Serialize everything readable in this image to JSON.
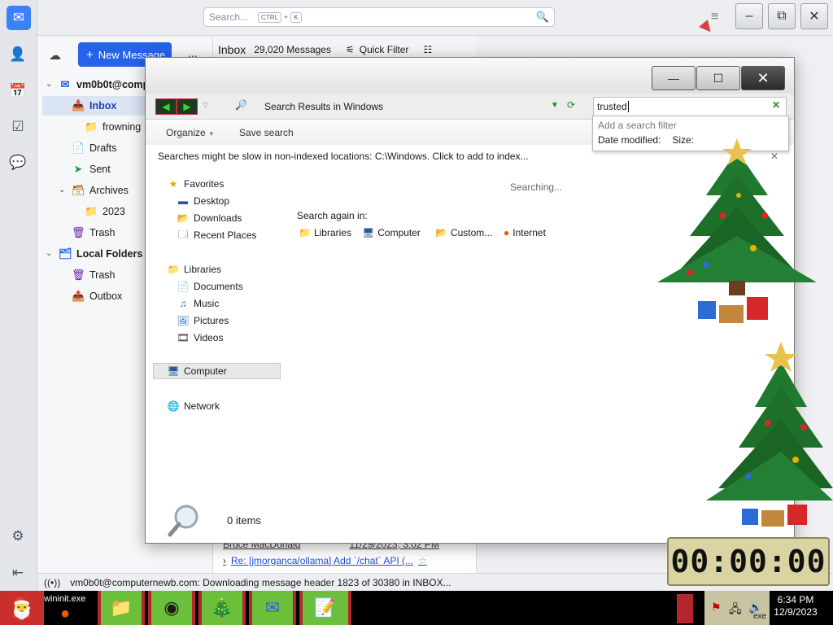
{
  "thunderbird": {
    "search_placeholder": "Search...",
    "search_shortcut_ctrl": "CTRL",
    "search_shortcut_plus": "+",
    "search_shortcut_key": "K",
    "new_message_label": "New Message",
    "more_label": "...",
    "account": "vm0b0t@comp",
    "folders": [
      {
        "label": "Inbox",
        "icon": "inbox-icon"
      },
      {
        "label": "frowning",
        "icon": "folder-icon"
      },
      {
        "label": "Drafts",
        "icon": "drafts-icon"
      },
      {
        "label": "Sent",
        "icon": "send-icon"
      },
      {
        "label": "Archives",
        "icon": "archive-icon"
      },
      {
        "label": "2023",
        "icon": "folder-icon"
      },
      {
        "label": "Trash",
        "icon": "trash-icon"
      }
    ],
    "local_folders_label": "Local Folders",
    "local_folders": [
      {
        "label": "Trash",
        "icon": "trash-icon"
      },
      {
        "label": "Outbox",
        "icon": "outbox-icon"
      }
    ],
    "list_title": "Inbox",
    "message_count": "29,020 Messages",
    "quick_filter_label": "Quick Filter",
    "message_rows": [
      {
        "sender": "Bruce MacDonald",
        "date": "11/29/2023, 3:02 PM"
      },
      {
        "subject": "Re: [jmorganca/ollama] Add `/chat` API (..."
      }
    ],
    "status_text": "vm0b0t@computernewb.com: Downloading message header 1823 of 30380 in INBOX..."
  },
  "explorer": {
    "address_text": "Search Results in Windows",
    "search_query": "trusted",
    "filter_title": "Add a search filter",
    "filter_date": "Date modified:",
    "filter_size": "Size:",
    "toolbar_organize": "Organize",
    "toolbar_save": "Save search",
    "info_message": "Searches might be slow in non-indexed locations: C:\\Windows. Click to add to index...",
    "searching_label": "Searching...",
    "search_again_label": "Search again in:",
    "search_again_items": [
      "Libraries",
      "Computer",
      "Custom...",
      "Internet"
    ],
    "nav": {
      "favorites": "Favorites",
      "desktop": "Desktop",
      "downloads": "Downloads",
      "recent": "Recent Places",
      "libraries": "Libraries",
      "documents": "Documents",
      "music": "Music",
      "pictures": "Pictures",
      "videos": "Videos",
      "computer": "Computer",
      "network": "Network"
    },
    "items_count": "0 items"
  },
  "gadgets": {
    "timer": "00:00:00"
  },
  "taskbar": {
    "taskbar_label": "wininit.exe",
    "tray_label": "exe",
    "time": "6:34 PM",
    "date": "12/9/2023"
  },
  "colors": {
    "accent": "#2563eb",
    "tree_green": "#1f7a2e",
    "taskbar_green": "#6bbf3a"
  }
}
